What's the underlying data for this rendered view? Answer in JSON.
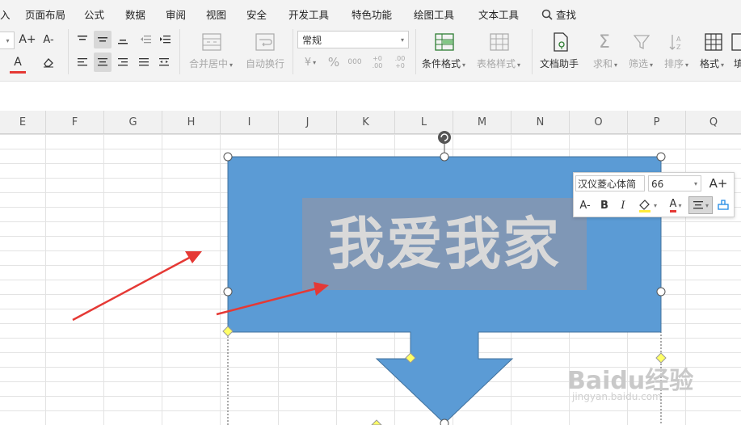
{
  "menu": {
    "items": [
      "入",
      "页面布局",
      "公式",
      "数据",
      "审阅",
      "视图",
      "安全",
      "开发工具",
      "特色功能",
      "绘图工具",
      "文本工具"
    ],
    "search_label": "查找"
  },
  "ribbon": {
    "number_format": "常规",
    "merge_label": "合并居中",
    "wrap_label": "自动换行",
    "cond_format_label": "条件格式",
    "table_style_label": "表格样式",
    "doc_helper_label": "文档助手",
    "sum_label": "求和",
    "filter_label": "筛选",
    "sort_label": "排序",
    "format_label": "格式",
    "fill_label": "填",
    "percent_glyph": "%",
    "comma_glyph": "000",
    "currency_glyph": "¥",
    "inc_dec_glyph": "+0 .00",
    "dec_dec_glyph": ".00 +0",
    "font_grow_glyph": "A+",
    "font_shrink_glyph": "A-",
    "font_color_glyph": "A",
    "eraser_glyph": "◇"
  },
  "columns": [
    "E",
    "F",
    "G",
    "H",
    "I",
    "J",
    "K",
    "L",
    "M",
    "N",
    "O",
    "P",
    "Q"
  ],
  "shape": {
    "text": "我爱我家",
    "fill_color": "#5b9bd5",
    "text_color": "#d9d9d9",
    "highlight_color": "#7f97b6"
  },
  "floating_toolbar": {
    "font_name": "汉仪菱心体简",
    "font_size": "66",
    "grow_glyph": "A+",
    "shrink_glyph": "A-",
    "bold_glyph": "B",
    "italic_glyph": "I",
    "color_glyph": "A"
  },
  "watermark": {
    "text": "Baidu经验",
    "url": "jingyan.baidu.com"
  },
  "colors": {
    "arrow_red": "#e53935",
    "accent": "#5b9bd5",
    "handle_yellow": "#ffff66"
  }
}
